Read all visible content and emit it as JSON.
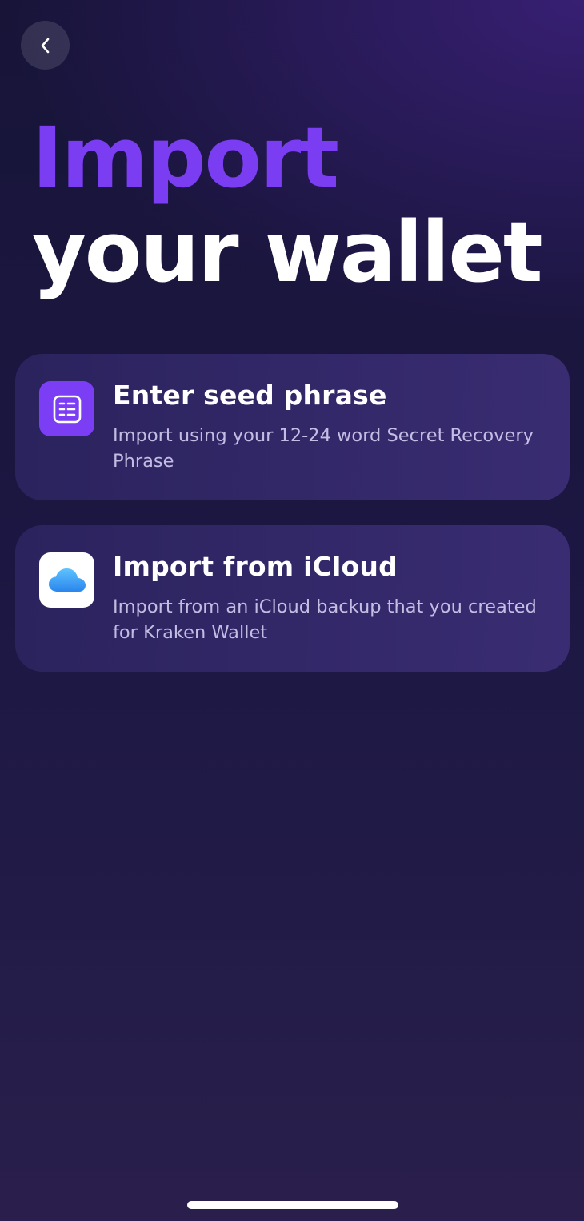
{
  "header": {
    "back_icon": "chevron-left-icon"
  },
  "title": {
    "line1": "Import",
    "line2": "your wallet",
    "line1_color": "#7a3df2",
    "line2_color": "#ffffff"
  },
  "options": [
    {
      "icon": "seed-phrase-list-icon",
      "title": "Enter seed phrase",
      "description": "Import using your 12-24 word Secret Recovery Phrase"
    },
    {
      "icon": "icloud-icon",
      "title": "Import from iCloud",
      "description": "Import from an iCloud backup that you created for Kraken Wallet"
    }
  ],
  "colors": {
    "accent": "#7b3ef5",
    "icloud_blue": "#3aa0f0"
  }
}
